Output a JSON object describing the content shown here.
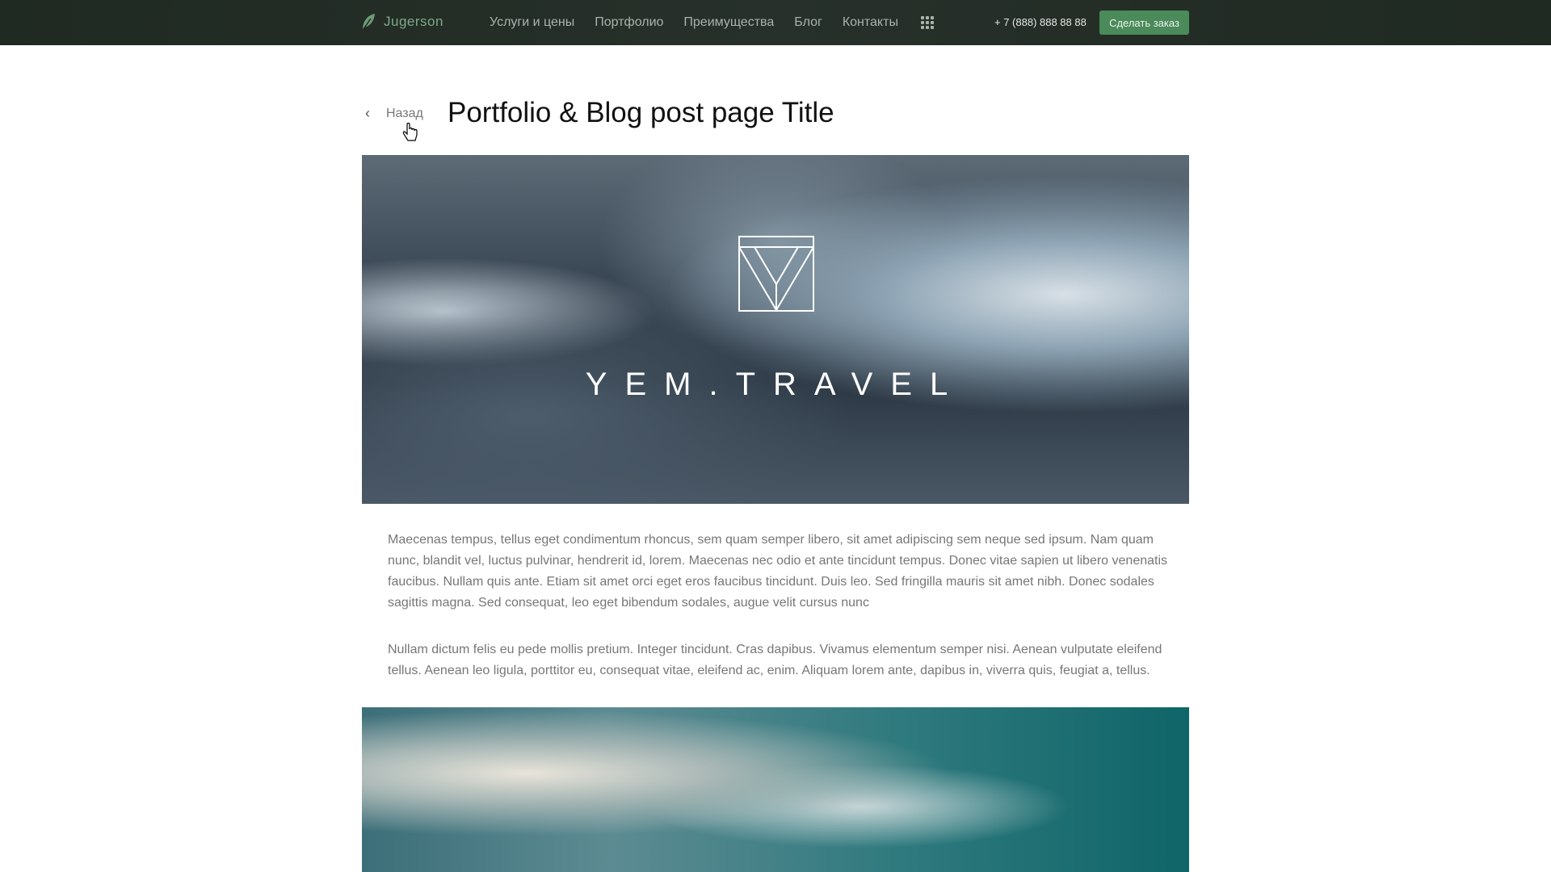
{
  "nav": {
    "brand": "Jugerson",
    "items": [
      "Услуги и цены",
      "Портфолио",
      "Преимущества",
      "Блог",
      "Контакты"
    ],
    "phone": "+ 7 (888) 888 88 88",
    "order_button": "Сделать заказ"
  },
  "page": {
    "back_label": "Назад",
    "title": "Portfolio & Blog post page Title"
  },
  "hero": {
    "logo_text": "YEM.TRAVEL"
  },
  "paragraphs": [
    "Maecenas tempus, tellus eget condimentum rhoncus, sem quam semper libero, sit amet adipiscing sem neque sed ipsum. Nam quam nunc, blandit vel, luctus pulvinar, hendrerit id, lorem. Maecenas nec odio et ante tincidunt tempus. Donec vitae sapien ut libero venenatis faucibus. Nullam quis ante. Etiam sit amet orci eget eros faucibus tincidunt. Duis leo. Sed fringilla mauris sit amet nibh. Donec sodales sagittis magna. Sed consequat, leo eget bibendum sodales, augue velit cursus nunc",
    "Nullam dictum felis eu pede mollis pretium. Integer tincidunt. Cras dapibus. Vivamus elementum semper nisi. Aenean vulputate eleifend tellus. Aenean leo ligula, porttitor eu, consequat vitae, eleifend ac, enim. Aliquam lorem ante, dapibus in, viverra quis, feugiat a, tellus."
  ]
}
